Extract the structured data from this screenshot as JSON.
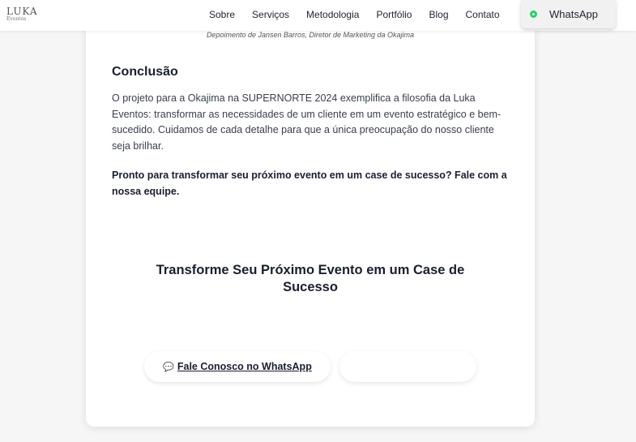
{
  "brand": {
    "name": "LUKA",
    "sub": "Eventos"
  },
  "nav": {
    "items": [
      "Sobre",
      "Serviços",
      "Metodologia",
      "Portfólio",
      "Blog",
      "Contato"
    ],
    "whatsapp_label": "WhatsApp",
    "whatsapp_icon": "whatsapp-icon"
  },
  "article": {
    "attribution": "Depoimento de Jansen Barros, Diretor de Marketing da Okajima",
    "conclusion_title": "Conclusão",
    "conclusion_text": "O projeto para a Okajima na SUPERNORTE 2024 exemplifica a filosofia da Luka Eventos: transformar as necessidades de um cliente em um evento estratégico e bem-sucedido. Cuidamos de cada detalhe para que a única preocupação do nosso cliente seja brilhar.",
    "cta_text": "Pronto para transformar seu próximo evento em um case de sucesso? Fale com a nossa equipe."
  },
  "cta_section": {
    "title": "Transforme Seu Próximo Evento em um Case de Sucesso",
    "whatsapp_button": "Fale Conosco no WhatsApp",
    "chat_icon": "💬",
    "secondary_button": ""
  },
  "colors": {
    "whatsapp_green": "#25d366",
    "text_dark": "#1a1f2e",
    "background": "#f6f6f7"
  }
}
